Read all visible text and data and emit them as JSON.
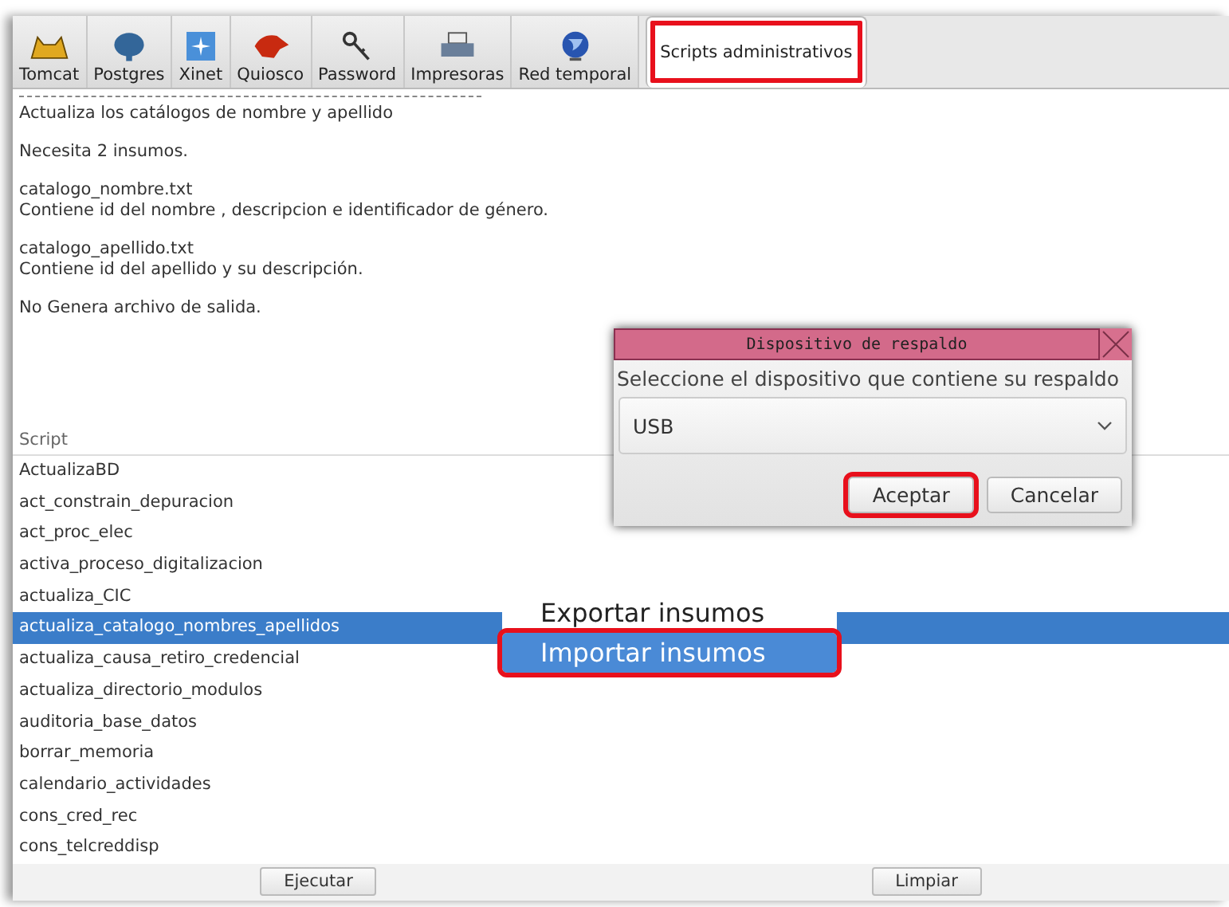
{
  "tabs": [
    {
      "label": "Tomcat",
      "selected": false,
      "highlighted": false
    },
    {
      "label": "Postgres",
      "selected": false,
      "highlighted": false
    },
    {
      "label": "Xinet",
      "selected": false,
      "highlighted": false
    },
    {
      "label": "Quiosco",
      "selected": false,
      "highlighted": false
    },
    {
      "label": "Password",
      "selected": false,
      "highlighted": false
    },
    {
      "label": "Impresoras",
      "selected": false,
      "highlighted": false
    },
    {
      "label": "Red temporal",
      "selected": false,
      "highlighted": false
    },
    {
      "label": "Scripts administrativos",
      "selected": true,
      "highlighted": true
    }
  ],
  "description": [
    [
      "Actualiza los catálogos de nombre y apellido"
    ],
    [
      "Necesita 2 insumos."
    ],
    [
      "catalogo_nombre.txt",
      "Contiene id del nombre  , descripcion e identificador de género."
    ],
    [
      "catalogo_apellido.txt",
      "Contiene id del apellido y su descripción."
    ],
    [
      "No Genera archivo de salida."
    ]
  ],
  "table": {
    "columns": [
      "Script"
    ],
    "rows": [
      {
        "name": "ActualizaBD",
        "selected": false
      },
      {
        "name": "act_constrain_depuracion",
        "selected": false
      },
      {
        "name": "act_proc_elec",
        "selected": false
      },
      {
        "name": "activa_proceso_digitalizacion",
        "selected": false
      },
      {
        "name": "actualiza_CIC",
        "selected": false
      },
      {
        "name": "actualiza_catalogo_nombres_apellidos",
        "selected": true
      },
      {
        "name": "actualiza_causa_retiro_credencial",
        "selected": false
      },
      {
        "name": "actualiza_directorio_modulos",
        "selected": false
      },
      {
        "name": "auditoria_base_datos",
        "selected": false
      },
      {
        "name": "borrar_memoria",
        "selected": false
      },
      {
        "name": "calendario_actividades",
        "selected": false
      },
      {
        "name": "cons_cred_rec",
        "selected": false
      },
      {
        "name": "cons_telcreddisp",
        "selected": false
      }
    ]
  },
  "buttons": [
    "Ejecutar",
    "Limpiar"
  ],
  "context_menu": [
    {
      "label": "Exportar insumos",
      "selected": false,
      "highlighted": false
    },
    {
      "label": "Importar insumos",
      "selected": true,
      "highlighted": true
    }
  ],
  "dialog": {
    "title": "Dispositivo de respaldo",
    "message": "Seleccione el dispositivo que contiene su respaldo",
    "device": "USB",
    "buttons": [
      {
        "label": "Aceptar",
        "highlighted": true
      },
      {
        "label": "Cancelar",
        "highlighted": false
      }
    ]
  }
}
